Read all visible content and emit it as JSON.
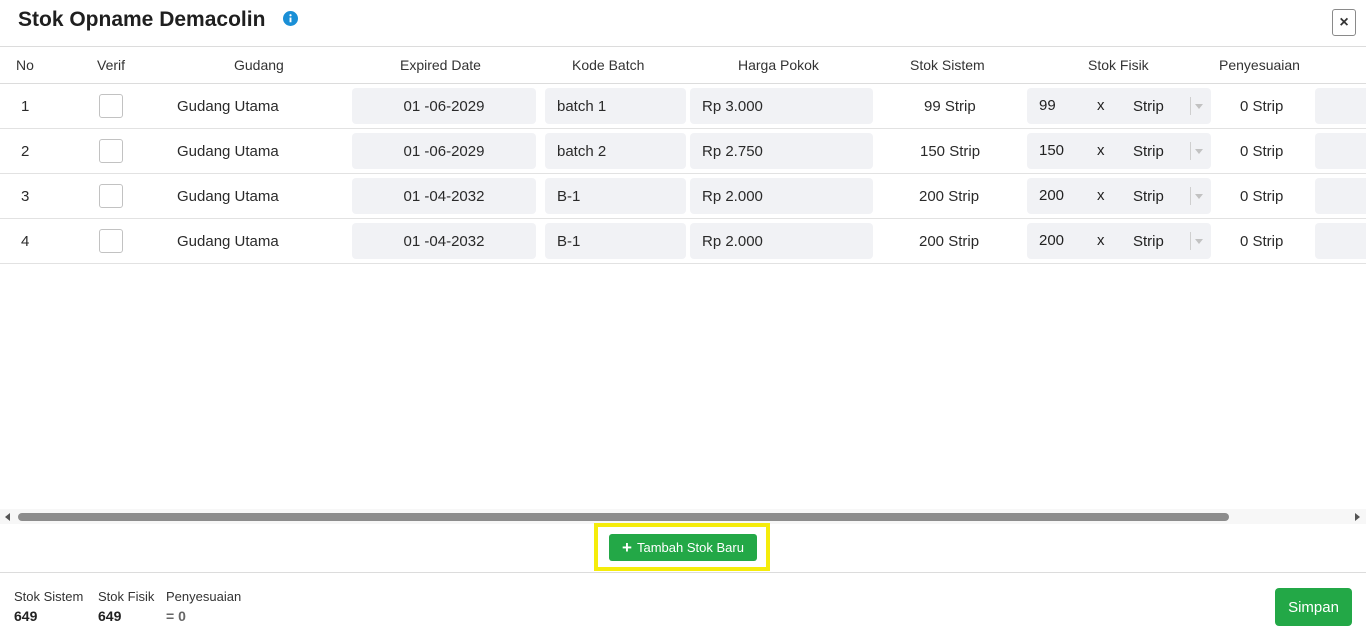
{
  "modal": {
    "title": "Stok Opname Demacolin",
    "close_label": "×"
  },
  "icons": {
    "info": "info-icon",
    "close": "close-icon",
    "plus": "plus-icon",
    "dropdown": "chevron-down-icon"
  },
  "colors": {
    "primary_green": "#23a847",
    "highlight_yellow": "#f5ec0b",
    "info_blue": "#1a8fd6",
    "field_bg": "#f1f2f5"
  },
  "table": {
    "headers": {
      "no": "No",
      "verif": "Verif",
      "gudang": "Gudang",
      "expired_date": "Expired Date",
      "kode_batch": "Kode Batch",
      "harga_pokok": "Harga Pokok",
      "stok_sistem": "Stok Sistem",
      "stok_fisik": "Stok Fisik",
      "penyesuaian": "Penyesuaian"
    },
    "rows": [
      {
        "no": "1",
        "gudang": "Gudang Utama",
        "expired_date": "01 -06-2029",
        "kode_batch": "batch 1",
        "harga_pokok": "Rp 3.000",
        "stok_sistem": "99 Strip",
        "stok_fisik_qty": "99",
        "multiplier": "x",
        "unit": "Strip",
        "penyesuaian": "0 Strip"
      },
      {
        "no": "2",
        "gudang": "Gudang Utama",
        "expired_date": "01 -06-2029",
        "kode_batch": "batch 2",
        "harga_pokok": "Rp 2.750",
        "stok_sistem": "150 Strip",
        "stok_fisik_qty": "150",
        "multiplier": "x",
        "unit": "Strip",
        "penyesuaian": "0 Strip"
      },
      {
        "no": "3",
        "gudang": "Gudang Utama",
        "expired_date": "01 -04-2032",
        "kode_batch": "B-1",
        "harga_pokok": "Rp 2.000",
        "stok_sistem": "200 Strip",
        "stok_fisik_qty": "200",
        "multiplier": "x",
        "unit": "Strip",
        "penyesuaian": "0 Strip"
      },
      {
        "no": "4",
        "gudang": "Gudang Utama",
        "expired_date": "01 -04-2032",
        "kode_batch": "B-1",
        "harga_pokok": "Rp 2.000",
        "stok_sistem": "200 Strip",
        "stok_fisik_qty": "200",
        "multiplier": "x",
        "unit": "Strip",
        "penyesuaian": "0 Strip"
      }
    ]
  },
  "actions": {
    "add_label": "Tambah Stok Baru",
    "save_label": "Simpan"
  },
  "summary": {
    "stok_sistem_label": "Stok Sistem",
    "stok_sistem_value": "649",
    "stok_fisik_label": "Stok Fisik",
    "stok_fisik_value": "649",
    "penyesuaian_label": "Penyesuaian",
    "penyesuaian_value": "= 0"
  }
}
